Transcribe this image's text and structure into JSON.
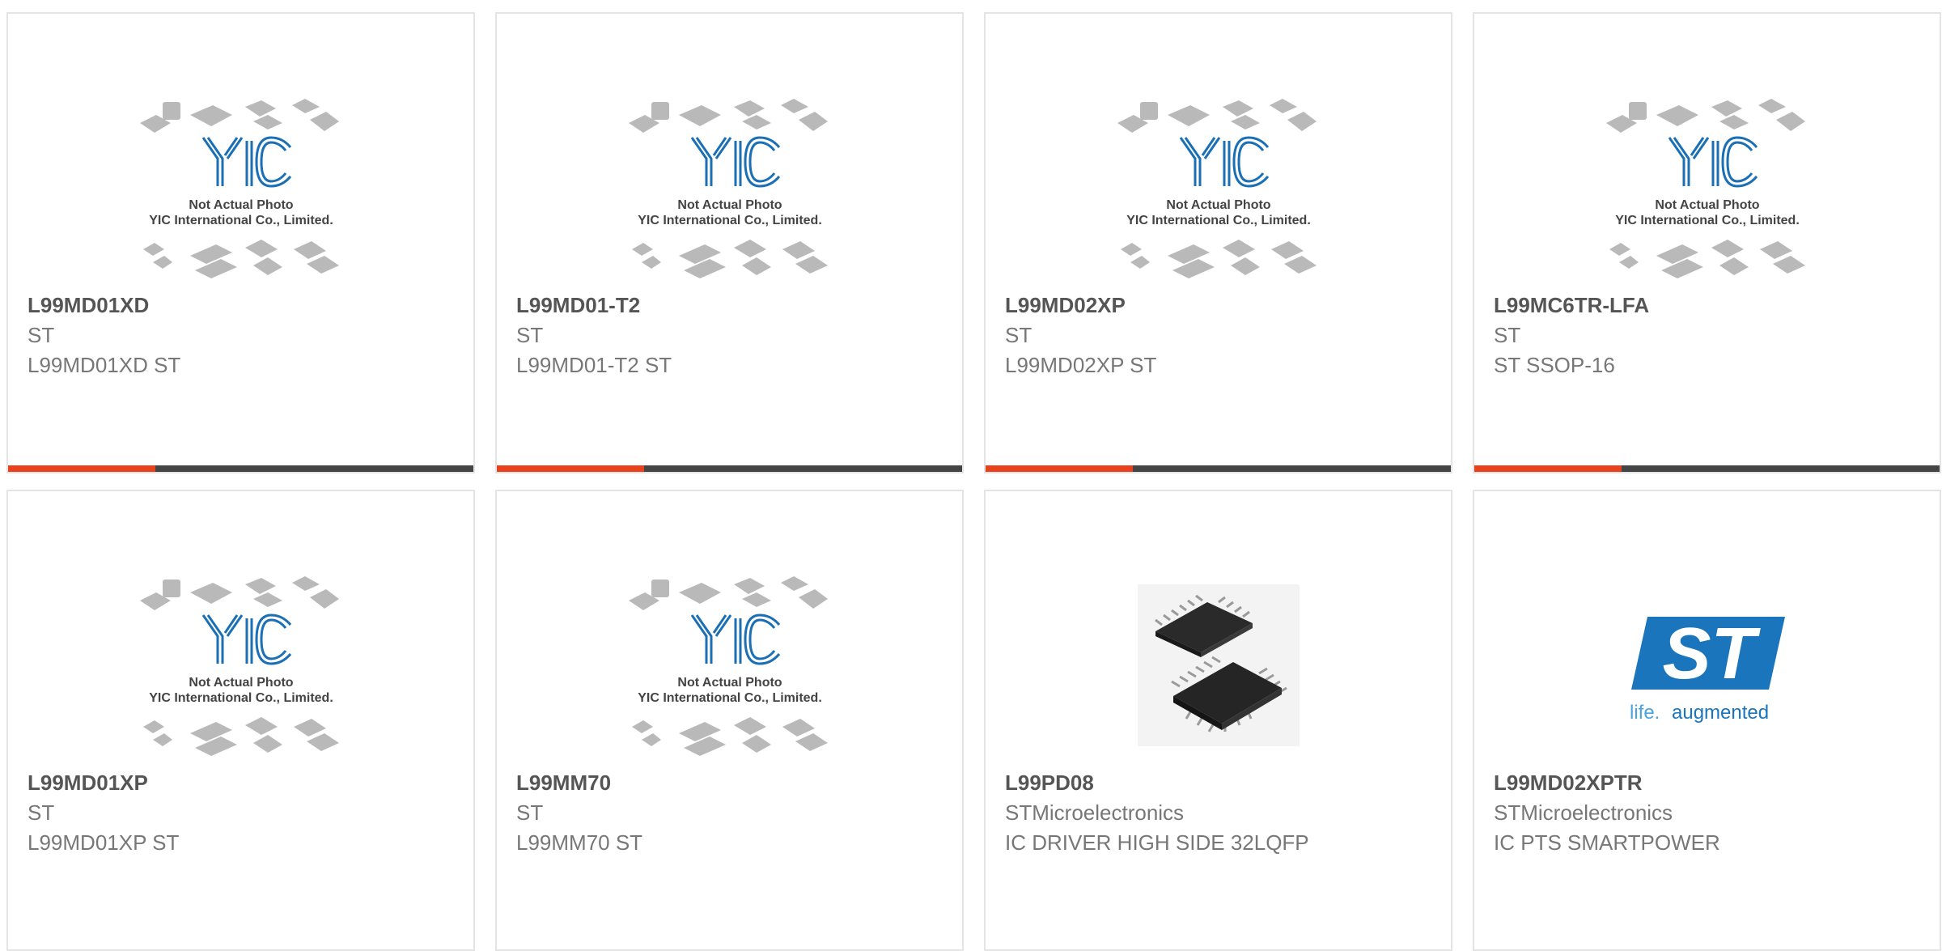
{
  "products": [
    {
      "image": "placeholder",
      "part_number": "L99MD01XD",
      "manufacturer": "ST",
      "description": "L99MD01XD ST",
      "placeholder_text": {
        "line1": "Not Actual Photo",
        "line2": "YIC International Co., Limited.",
        "logo": "YIC"
      },
      "accent_bar": true
    },
    {
      "image": "placeholder",
      "part_number": "L99MD01-T2",
      "manufacturer": "ST",
      "description": "L99MD01-T2 ST",
      "placeholder_text": {
        "line1": "Not Actual Photo",
        "line2": "YIC International Co., Limited.",
        "logo": "YIC"
      },
      "accent_bar": true
    },
    {
      "image": "placeholder",
      "part_number": "L99MD02XP",
      "manufacturer": "ST",
      "description": "L99MD02XP ST",
      "placeholder_text": {
        "line1": "Not Actual Photo",
        "line2": "YIC International Co., Limited.",
        "logo": "YIC"
      },
      "accent_bar": true
    },
    {
      "image": "placeholder",
      "part_number": "L99MC6TR-LFA",
      "manufacturer": "ST",
      "description": "ST SSOP-16",
      "placeholder_text": {
        "line1": "Not Actual Photo",
        "line2": "YIC International Co., Limited.",
        "logo": "YIC"
      },
      "accent_bar": true
    },
    {
      "image": "placeholder",
      "part_number": "L99MD01XP",
      "manufacturer": "ST",
      "description": "L99MD01XP ST",
      "placeholder_text": {
        "line1": "Not Actual Photo",
        "line2": "YIC International Co., Limited.",
        "logo": "YIC"
      },
      "accent_bar": false
    },
    {
      "image": "placeholder",
      "part_number": "L99MM70",
      "manufacturer": "ST",
      "description": "L99MM70 ST",
      "placeholder_text": {
        "line1": "Not Actual Photo",
        "line2": "YIC International Co., Limited.",
        "logo": "YIC"
      },
      "accent_bar": false
    },
    {
      "image": "chip-photo",
      "part_number": "L99PD08",
      "manufacturer": "STMicroelectronics",
      "description": "IC DRIVER HIGH SIDE 32LQFP",
      "accent_bar": false
    },
    {
      "image": "st-logo",
      "part_number": "L99MD02XPTR",
      "manufacturer": "STMicroelectronics",
      "description": "IC PTS SMARTPOWER",
      "logo_text": {
        "brand": "ST",
        "tagline_a": "life.",
        "tagline_b": "augmented"
      },
      "accent_bar": false
    }
  ],
  "colors": {
    "accent": "#e8411c",
    "bar": "#444444",
    "yic_blue": "#1a6fb5",
    "st_blue": "#1a75bc",
    "title": "#555555",
    "text": "#777777"
  }
}
